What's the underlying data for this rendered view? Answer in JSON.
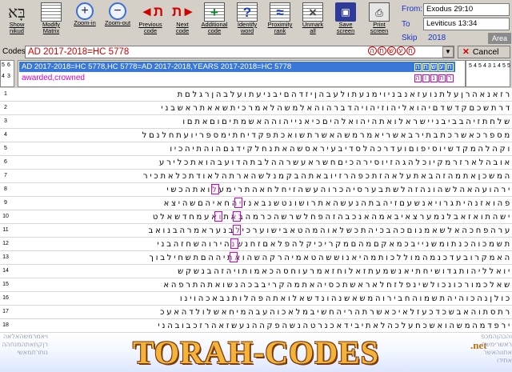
{
  "toolbar": {
    "buttons": [
      {
        "label": "Show\nnikud",
        "icon": "hebrew-letters-icon"
      },
      {
        "label": "Modify\nMatrix",
        "icon": "matrix-grid-icon"
      },
      {
        "label": "Zoom-in",
        "icon": "zoom-in-icon"
      },
      {
        "label": "Zoom-out",
        "icon": "zoom-out-icon"
      },
      {
        "label": "Previous\ncode",
        "icon": "previous-code-icon"
      },
      {
        "label": "Next\ncode",
        "icon": "next-code-icon"
      },
      {
        "label": "Additional\ncode",
        "icon": "additional-code-icon"
      },
      {
        "label": "Identify\nword",
        "icon": "identify-word-icon"
      },
      {
        "label": "Proximity\nrank",
        "icon": "proximity-rank-icon"
      },
      {
        "label": "Unmark\nall",
        "icon": "unmark-all-icon"
      },
      {
        "label": "Save\nscreen",
        "icon": "save-disk-icon"
      },
      {
        "label": "Print\nscreen",
        "icon": "printer-icon"
      }
    ]
  },
  "range": {
    "from_label": "From:",
    "from_value": "Exodus 29:10",
    "to_label": "To",
    "to_value": "Leviticus 13:34",
    "skip_label": "Skip",
    "skip_value": "2018",
    "area_label": "Area"
  },
  "codes": {
    "label": "Codes:",
    "value": "AD 2017-2018=HC 5778",
    "hebrew": "התשעח",
    "cancel_label": "Cancel"
  },
  "terms": {
    "number_column": [
      "5",
      "6",
      "4",
      "3"
    ],
    "list": [
      {
        "text": "AD 2017-2018=HC 5778,HC 5778=AD 2017-2018,YEARS 2017-2018=HC 5778",
        "tag": "התשעח"
      },
      {
        "text": "awarded,crowned",
        "tag": "הונתר"
      }
    ],
    "right_numbers": [
      "5",
      "4",
      "5",
      "4",
      "3",
      "1",
      "4",
      "5",
      "5"
    ]
  },
  "grid": {
    "rows": [
      {
        "n": "1",
        "text": "רזאנאהרןעלתנועזאנבניוימנעתולעבהןיזדהםיבניעתועלבהןרגלםת"
      },
      {
        "n": "2",
        "text": "דרתשכםקדשדםיהואליהוזיהויהדברהוהאלמשהלאמרכיתשאאתראשבני"
      },
      {
        "n": "3",
        "text": "שלחתזיהבביבניישראלואתהיהואלהיםכיאנייהוההאשמתיםוםאתםו"
      },
      {
        "n": "4",
        "text": "מספרכאשרכתבתירבאשריאמרמשהאשרתשואכתפקדיחתימספריועתחלנםל"
      },
      {
        "n": "5",
        "text": "וקהלהמקדשיוסיפוםועדרכהלסדיבעיראסשהאתנחלקידגםהוהתיהכיו"
      },
      {
        "n": "6",
        "text": "אובהלארזרמקיוכלהגהזיוסירהכיםחשראעשרההלבתהדועבהואתכלירע"
      },
      {
        "n": "7",
        "text": "המשכןאתמהזהבאתעלאהזתכפהרזיובאתהבקמנלשהארתהלאודתכלאתכיר"
      },
      {
        "n": "8",
        "text": "ירהועהאהלשהונהזהלשתבערסיהכרוהעשהזיחלחאהתרימעלואתהכשי"
      },
      {
        "n": "9",
        "text": "פהואזנהיתגרויאנשעםזיהבתהנעשהאתרושונטשנבאנזיהחאיהםשהיצא"
      },
      {
        "n": "10",
        "text": "ישהתואזאבלנמערצאיבאמהאנכבהזהפחלשרשהכרמהבאתואעמחדשאלט"
      },
      {
        "n": "11",
        "text": "ערהפחכהאלשאמנוםכהבכיהתכשלאוהמהטאבישוערכילבנעראמרהבנואב"
      },
      {
        "n": "12",
        "text": "תשמכוהכנתומשנייבכמאקםמהםמקריכיקלהפלאםזחנשנהירוהשחזהבני"
      },
      {
        "n": "13",
        "text": "האמקרובעדכנמהמוללכותמהיאנוששהטאמיהרקהשהואתיההםתשחילבוך"
      },
      {
        "n": "14",
        "text": "יואלליהותגדושיחתיאנשמעתזאלוחזאמרעוחסהכאמותויהזהבנשקש"
      },
      {
        "n": "15",
        "text": "שאלכמורכונכולשינפלזחלאראשתכסיהאתמהקריבבכהנשואתהתרפהא"
      },
      {
        "n": "16",
        "text": "כולןנהכוהיהתשמוהחבירוהמשאשנהונדשאלואתהפהלותנבאכהוינו"
      },
      {
        "n": "17",
        "text": "רתסתוהאבשכדכעזלאיכאשרתהריהחשיבמלאכוהעבהמיחאשלולדהאעכ"
      },
      {
        "n": "18",
        "text": "ירפדמהמשהואשכחעלכהלאתיבידאכנרטהנשהפקההנעשזאהרזכבובהני"
      }
    ]
  },
  "footer": {
    "banner": "TORAH-CODES",
    "suffix": ".net",
    "left_strip": "ויאמרמשהאלאהרןקחאתהמנחההנותרתמאשי",
    "right_strip": "והכהןהמכפראשרימשחאתווהאשראתידו"
  },
  "colors": {
    "accent_blue": "#1a35c8",
    "code_red": "#d40000",
    "term_magenta": "#d000c8",
    "selection_blue": "#3a78d8"
  }
}
